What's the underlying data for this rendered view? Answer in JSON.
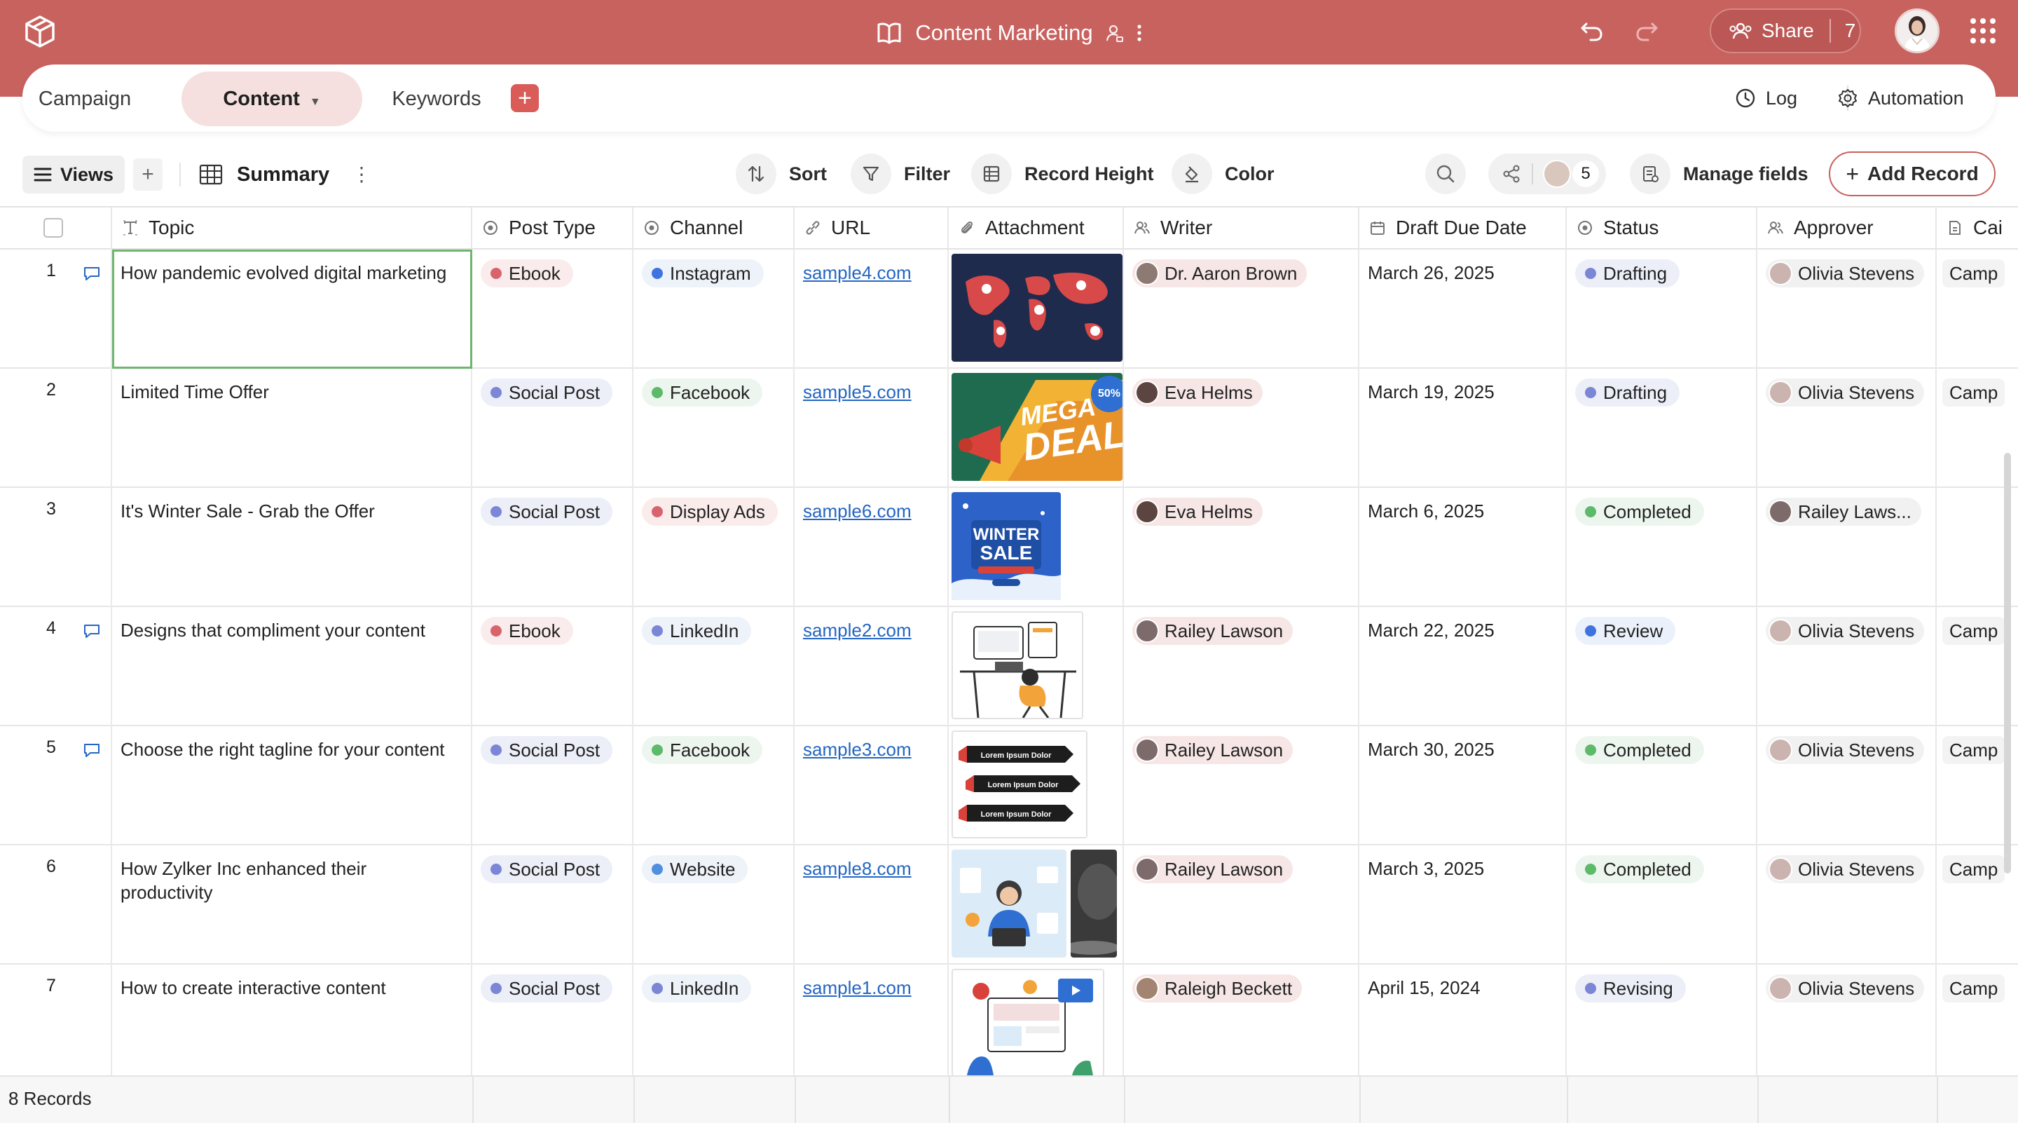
{
  "app": {
    "title": "Content Marketing",
    "share_label": "Share",
    "share_count": "7",
    "accent": "#c8625f"
  },
  "tabs": [
    {
      "label": "Campaign"
    },
    {
      "label": "Content",
      "active": true
    },
    {
      "label": "Keywords"
    }
  ],
  "header_actions": {
    "log": "Log",
    "automation": "Automation"
  },
  "toolbar": {
    "views": "Views",
    "view_name": "Summary",
    "sort": "Sort",
    "filter": "Filter",
    "record_height": "Record Height",
    "color": "Color",
    "collaborators": "5",
    "manage_fields": "Manage fields",
    "add_record": "Add Record"
  },
  "columns": [
    "Topic",
    "Post Type",
    "Channel",
    "URL",
    "Attachment",
    "Writer",
    "Draft Due Date",
    "Status",
    "Approver",
    "Cai"
  ],
  "rows": [
    {
      "num": "1",
      "comment": true,
      "topic": "How pandemic evolved digital marketing",
      "post_type": "Ebook",
      "channel": "Instagram",
      "url": "sample4.com",
      "writer": "Dr. Aaron Brown",
      "due": "March 26, 2025",
      "status": "Drafting",
      "approver": "Olivia Stevens",
      "camp": "Camp"
    },
    {
      "num": "2",
      "comment": false,
      "topic": "Limited Time Offer",
      "post_type": "Social Post",
      "channel": "Facebook",
      "url": "sample5.com",
      "writer": "Eva Helms",
      "due": "March 19, 2025",
      "status": "Drafting",
      "approver": "Olivia Stevens",
      "camp": "Camp"
    },
    {
      "num": "3",
      "comment": false,
      "topic": "It's Winter Sale - Grab the Offer",
      "post_type": "Social Post",
      "channel": "Display Ads",
      "url": "sample6.com",
      "writer": "Eva Helms",
      "due": "March 6, 2025",
      "status": "Completed",
      "approver": "Railey Laws...",
      "camp": ""
    },
    {
      "num": "4",
      "comment": true,
      "topic": "Designs that compliment your content",
      "post_type": "Ebook",
      "channel": "LinkedIn",
      "url": "sample2.com",
      "writer": "Railey Lawson",
      "due": "March 22, 2025",
      "status": "Review",
      "approver": "Olivia Stevens",
      "camp": "Camp"
    },
    {
      "num": "5",
      "comment": true,
      "topic": "Choose the right tagline for your content",
      "post_type": "Social Post",
      "channel": "Facebook",
      "url": "sample3.com",
      "writer": "Railey Lawson",
      "due": "March 30, 2025",
      "status": "Completed",
      "approver": "Olivia Stevens",
      "camp": "Camp"
    },
    {
      "num": "6",
      "comment": false,
      "topic": "How Zylker Inc enhanced their productivity",
      "post_type": "Social Post",
      "channel": "Website",
      "url": "sample8.com",
      "writer": "Railey Lawson",
      "due": "March 3, 2025",
      "status": "Completed",
      "approver": "Olivia Stevens",
      "camp": "Camp"
    },
    {
      "num": "7",
      "comment": false,
      "topic": "How to create interactive content",
      "post_type": "Social Post",
      "channel": "LinkedIn",
      "url": "sample1.com",
      "writer": "Raleigh Beckett",
      "due": "April 15, 2024",
      "status": "Revising",
      "approver": "Olivia Stevens",
      "camp": "Camp"
    }
  ],
  "attachments": {
    "row2_line1": "MEGA",
    "row2_line2": "DEAL",
    "row2_badge": "50%",
    "row3_line1": "WINTER",
    "row3_line2": "SALE",
    "row5_line": "Lorem Ipsum Dolor"
  },
  "footer": {
    "records": "8 Records"
  },
  "colors": {
    "ebook_dot": "#d9636d",
    "social_dot": "#7b86d6",
    "instagram_dot": "#3f74e0",
    "facebook_dot": "#5cba6a",
    "displayads_dot": "#d9636d",
    "linkedin_dot": "#7b86d6",
    "website_dot": "#4f8fe0",
    "drafting_dot": "#7b86d6",
    "completed_dot": "#5cba6a",
    "review_dot": "#3f74e0",
    "revising_dot": "#7b86d6"
  }
}
